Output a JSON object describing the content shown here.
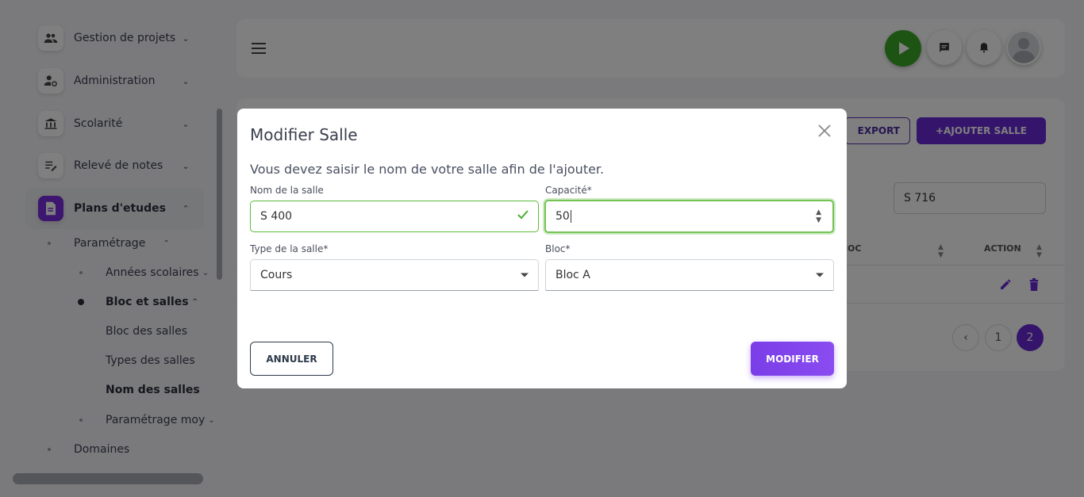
{
  "sidebar": {
    "items": [
      {
        "label": "Gestion de projets"
      },
      {
        "label": "Administration"
      },
      {
        "label": "Scolarité"
      },
      {
        "label": "Relevé de notes"
      },
      {
        "label": "Plans d'etudes"
      }
    ],
    "sub": {
      "parametrage": "Paramétrage",
      "annees": "Années scolaires",
      "bloc_salles": "Bloc et salles",
      "bloc_des_salles": "Bloc des salles",
      "types_salles": "Types des salles",
      "nom_salles": "Nom des salles",
      "param_moy": "Paramétrage moy",
      "domaines": "Domaines"
    }
  },
  "toolbar": {
    "export_label": "EXPORT",
    "add_label": "+AJOUTER SALLE",
    "search_value": "S 716"
  },
  "table": {
    "headers": [
      "OC",
      "ACTION"
    ]
  },
  "pagination": {
    "pages": [
      "1",
      "2"
    ],
    "current": "2"
  },
  "modal": {
    "title": "Modifier Salle",
    "description": "Vous devez saisir le nom de votre salle afin de l'ajouter.",
    "nom_label": "Nom de la salle",
    "nom_value": "S 400",
    "capacite_label": "Capacité*",
    "capacite_value": "50",
    "type_label": "Type de la salle*",
    "type_value": "Cours",
    "bloc_label": "Bloc*",
    "bloc_value": "Bloc A",
    "cancel_label": "ANNULER",
    "save_label": "MODIFIER"
  },
  "colors": {
    "accent": "#6a2bd6",
    "success": "#5bbd3a",
    "play": "#3aa829"
  }
}
